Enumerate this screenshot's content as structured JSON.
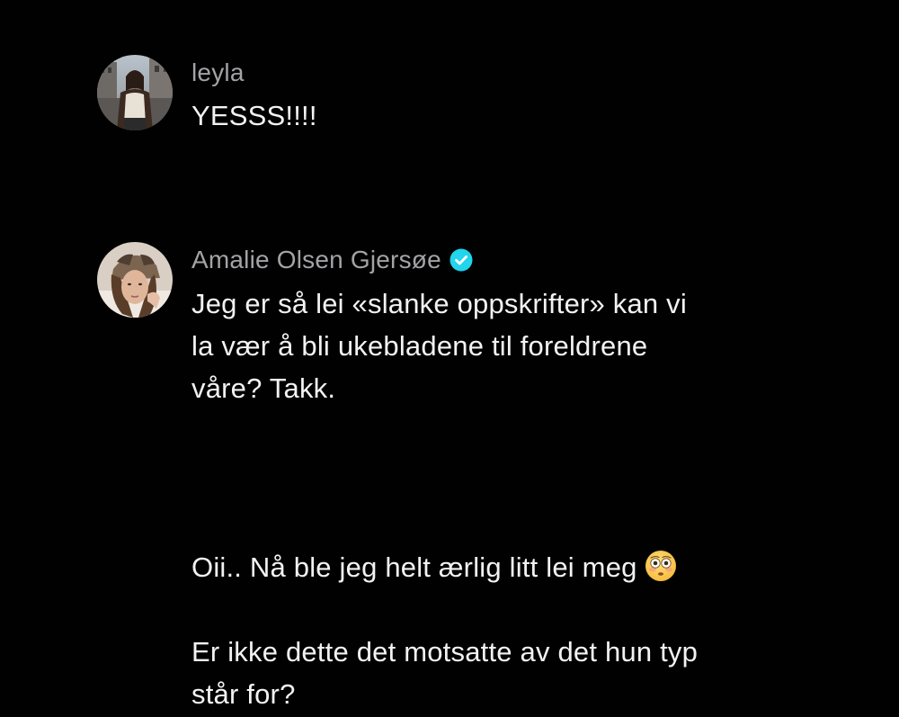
{
  "comments": [
    {
      "username": "leyla",
      "text": "YESSS!!!!",
      "verified": false,
      "avatar_icon": "user-avatar-leyla"
    },
    {
      "username": "Amalie Olsen Gjersøe",
      "text": "Jeg er så lei «slanke oppskrifter» kan vi\nla vær å bli ukebladene til foreldrene\nvåre? Takk.",
      "verified": true,
      "verified_icon": "verified-badge-icon",
      "verified_color": "#20d5ec",
      "avatar_icon": "user-avatar-amalie"
    },
    {
      "text_line1": "Oii.. Nå ble jeg helt ærlig litt lei meg",
      "emoji": "flushed-face-emoji",
      "text_rest": "Er ikke dette det motsatte av det hun typ\nstår for?"
    }
  ],
  "colors": {
    "background": "#010101",
    "username": "#a3a3a6",
    "text": "#f2f2f2"
  }
}
